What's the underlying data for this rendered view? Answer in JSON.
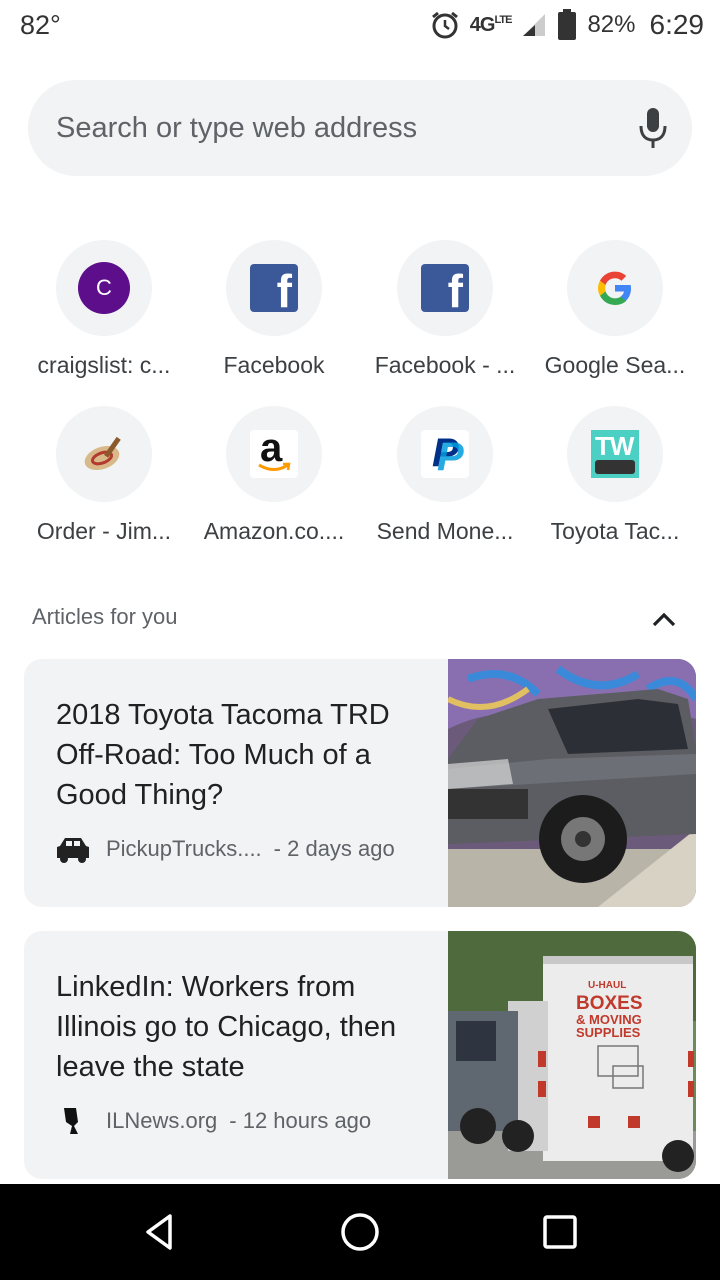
{
  "status_bar": {
    "temperature": "82°",
    "network": "4G",
    "network_sub": "LTE",
    "battery": "82%",
    "time": "6:29"
  },
  "search": {
    "placeholder": "Search or type web address"
  },
  "tiles": [
    {
      "label": "craigslist: c...",
      "icon": "craigslist-icon",
      "letter": "C"
    },
    {
      "label": "Facebook",
      "icon": "facebook-icon",
      "letter": "f"
    },
    {
      "label": "Facebook - ...",
      "icon": "facebook-icon",
      "letter": "f"
    },
    {
      "label": "Google Sea...",
      "icon": "google-icon"
    },
    {
      "label": "Order - Jim...",
      "icon": "order-site-icon"
    },
    {
      "label": "Amazon.co....",
      "icon": "amazon-icon",
      "letter": "a"
    },
    {
      "label": "Send Mone...",
      "icon": "paypal-icon",
      "letter": "P"
    },
    {
      "label": "Toyota Tac...",
      "icon": "toyota-world-icon",
      "letter": "TW"
    }
  ],
  "articles": {
    "header": "Articles for you",
    "items": [
      {
        "title": "2018 Toyota Tacoma TRD Off-Road: Too Much of a Good Thing?",
        "source": "PickupTrucks....",
        "time": "- 2 days ago"
      },
      {
        "title": "LinkedIn: Workers from Illinois go to Chicago, then leave the state",
        "source": "ILNews.org",
        "time": "- 12 hours ago"
      }
    ]
  },
  "images": {
    "truck_sign": [
      "U-HAUL",
      "BOXES",
      "& MOVING",
      "SUPPLIES"
    ]
  },
  "colors": {
    "accent_gray": "#f1f3f4",
    "craigslist_purple": "#5c0e8b",
    "facebook_blue": "#3b5998"
  }
}
